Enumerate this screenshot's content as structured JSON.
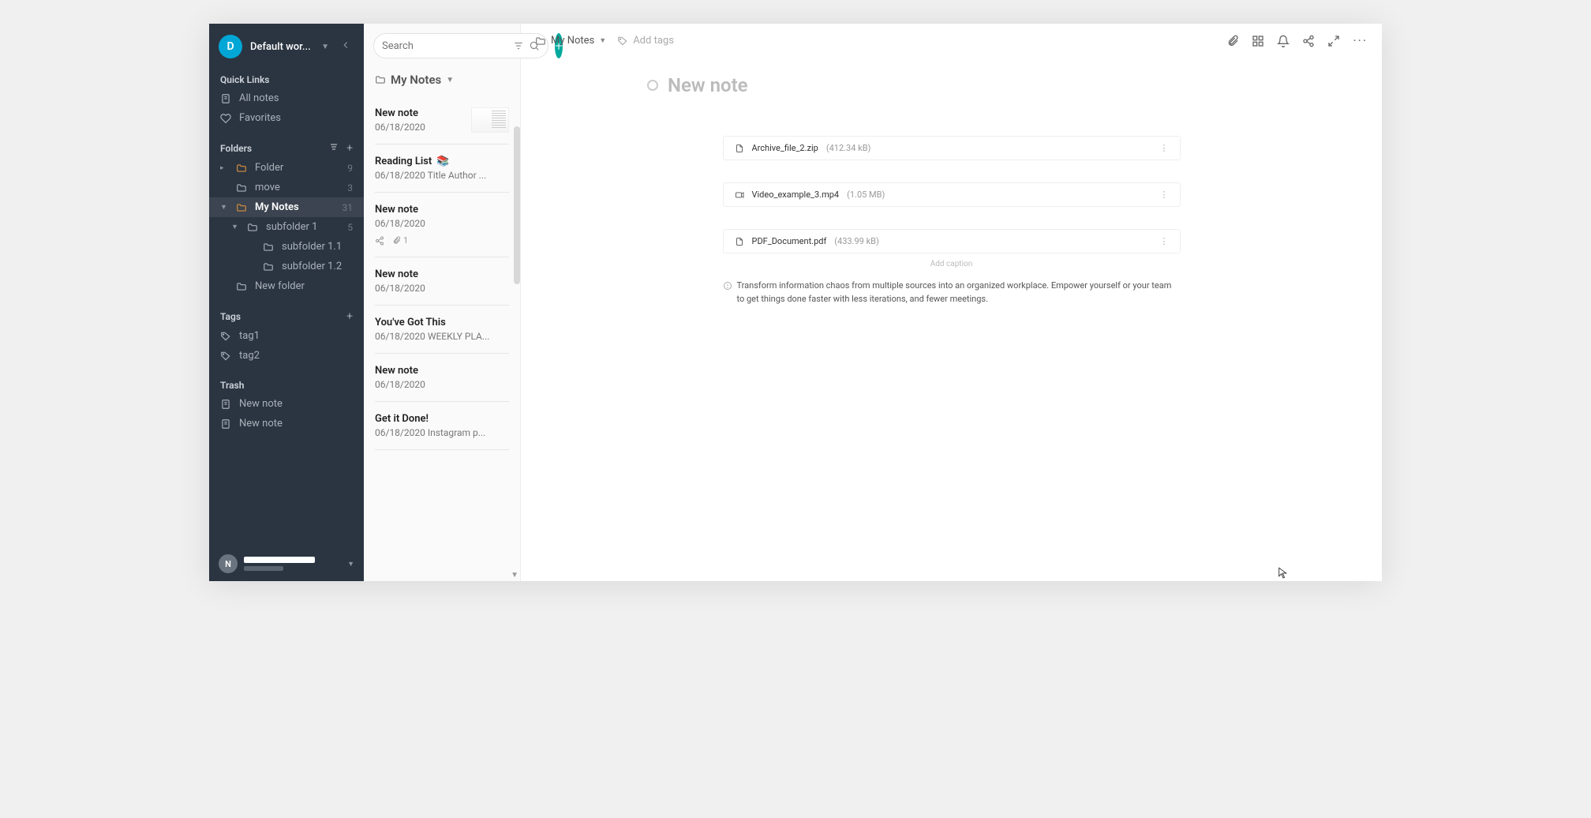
{
  "workspace": {
    "initial": "D",
    "name": "Default wor..."
  },
  "sidebar": {
    "quick_links_title": "Quick Links",
    "all_notes": "All notes",
    "favorites": "Favorites",
    "folders_title": "Folders",
    "folders": [
      {
        "name": "Folder",
        "count": "9",
        "depth": 0,
        "expandable": true,
        "expanded": false,
        "bold": false
      },
      {
        "name": "move",
        "count": "3",
        "depth": 0,
        "expandable": false,
        "bold": false
      },
      {
        "name": "My Notes",
        "count": "31",
        "depth": 0,
        "expandable": true,
        "expanded": true,
        "bold": true,
        "active": true
      },
      {
        "name": "subfolder 1",
        "count": "5",
        "depth": 1,
        "expandable": true,
        "expanded": true,
        "bold": false
      },
      {
        "name": "subfolder 1.1",
        "count": "",
        "depth": 2,
        "expandable": false,
        "bold": false
      },
      {
        "name": "subfolder 1.2",
        "count": "",
        "depth": 2,
        "expandable": false,
        "bold": false
      },
      {
        "name": "New folder",
        "count": "",
        "depth": 0,
        "expandable": false,
        "bold": false
      }
    ],
    "tags_title": "Tags",
    "tags": [
      "tag1",
      "tag2"
    ],
    "trash_title": "Trash",
    "trash_items": [
      "New note",
      "New note"
    ],
    "user_initial": "N"
  },
  "notelist": {
    "search_placeholder": "Search",
    "breadcrumb": "My Notes",
    "items": [
      {
        "title": "New note",
        "date": "06/18/2020",
        "excerpt": "",
        "thumb": true
      },
      {
        "title": "Reading List",
        "date": "06/18/2020",
        "excerpt": "Title Author ...",
        "emoji": "📚"
      },
      {
        "title": "New note",
        "date": "06/18/2020",
        "excerpt": "",
        "share": true,
        "attach_count": "1"
      },
      {
        "title": "New note",
        "date": "06/18/2020",
        "excerpt": ""
      },
      {
        "title": "You've Got This",
        "date": "06/18/2020",
        "excerpt": "WEEKLY PLA..."
      },
      {
        "title": "New note",
        "date": "06/18/2020",
        "excerpt": ""
      },
      {
        "title": "Get it Done!",
        "date": "06/18/2020",
        "excerpt": "Instagram p..."
      }
    ]
  },
  "editor": {
    "breadcrumb": "My Notes",
    "add_tags": "Add tags",
    "title": "New note",
    "attachments": [
      {
        "name": "Archive_file_2.zip",
        "size": "(412.34 kB)",
        "kind": "file"
      },
      {
        "name": "Video_example_3.mp4",
        "size": "(1.05 MB)",
        "kind": "video"
      },
      {
        "name": "PDF_Document.pdf",
        "size": "(433.99 kB)",
        "kind": "file"
      }
    ],
    "caption": "Add caption",
    "body": "Transform information chaos from multiple sources into an organized workplace. Empower yourself or your team to get things done faster with less iterations, and fewer meetings."
  }
}
